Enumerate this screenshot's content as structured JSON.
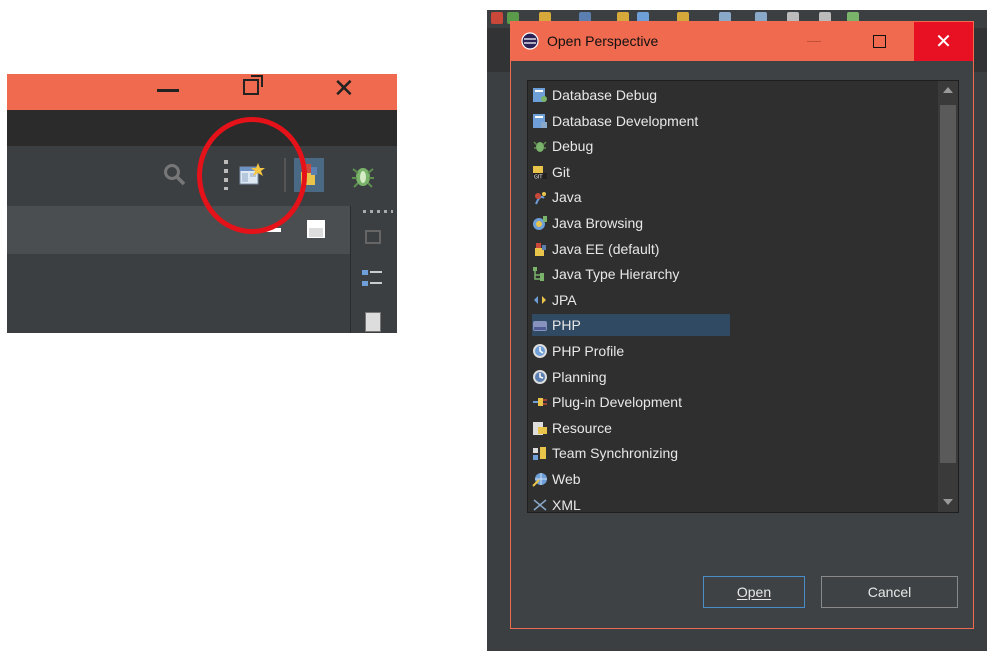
{
  "dialog": {
    "title": "Open Perspective",
    "minimize": "—",
    "close": "✕",
    "open_label": "Open",
    "cancel_label": "Cancel"
  },
  "perspectives": [
    {
      "label": "Database Debug",
      "icon": "database-debug-icon"
    },
    {
      "label": "Database Development",
      "icon": "database-development-icon"
    },
    {
      "label": "Debug",
      "icon": "debug-bug-icon"
    },
    {
      "label": "Git",
      "icon": "git-icon"
    },
    {
      "label": "Java",
      "icon": "java-icon"
    },
    {
      "label": "Java Browsing",
      "icon": "java-browsing-icon"
    },
    {
      "label": "Java EE (default)",
      "icon": "java-ee-icon"
    },
    {
      "label": "Java Type Hierarchy",
      "icon": "type-hierarchy-icon"
    },
    {
      "label": "JPA",
      "icon": "jpa-icon"
    },
    {
      "label": "PHP",
      "icon": "php-icon",
      "selected": true
    },
    {
      "label": "PHP Profile",
      "icon": "php-profile-icon"
    },
    {
      "label": "Planning",
      "icon": "planning-icon"
    },
    {
      "label": "Plug-in Development",
      "icon": "plugin-development-icon"
    },
    {
      "label": "Resource",
      "icon": "resource-icon"
    },
    {
      "label": "Team Synchronizing",
      "icon": "team-synchronizing-icon"
    },
    {
      "label": "Web",
      "icon": "web-icon"
    },
    {
      "label": "XML",
      "icon": "xml-icon"
    }
  ],
  "colors": {
    "title_bar": "#ef6a4e",
    "close_button": "#e81123",
    "highlight_circle": "#e5121a",
    "selection": "#2f4a62"
  }
}
